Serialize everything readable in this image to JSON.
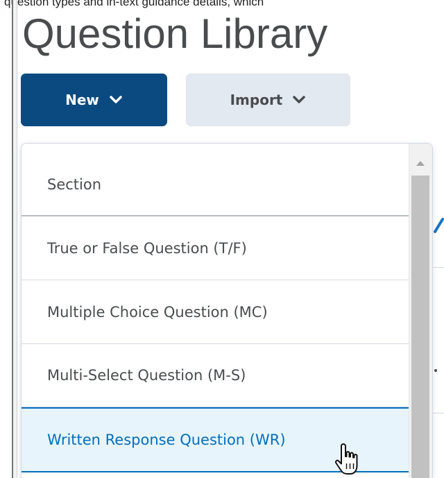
{
  "header": {
    "top_strip_text": "question types and in-text guidance details, which",
    "title": "Question Library"
  },
  "toolbar": {
    "new_label": "New",
    "import_label": "Import"
  },
  "menu": {
    "items": [
      {
        "label": "Section"
      },
      {
        "label": "True or False Question (T/F)"
      },
      {
        "label": "Multiple Choice Question (MC)"
      },
      {
        "label": "Multi-Select Question (M-S)"
      },
      {
        "label": "Written Response Question (WR)"
      }
    ],
    "hovered_index": 4
  },
  "colors": {
    "primary": "#0b4a80",
    "hover_text": "#006fbf",
    "hover_bg": "#e8f4fb"
  },
  "icons": [
    "chevron-down-icon",
    "hand-pointer-cursor-icon"
  ]
}
